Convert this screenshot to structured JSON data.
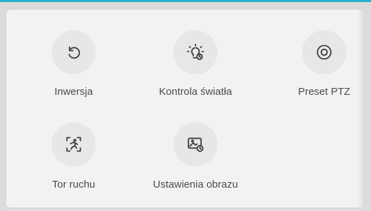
{
  "grid": {
    "items": [
      {
        "label": "Inwersja",
        "icon": "rotate-icon"
      },
      {
        "label": "Kontrola światła",
        "icon": "light-control-icon"
      },
      {
        "label": "Preset PTZ",
        "icon": "preset-ptz-icon"
      },
      {
        "label": "Tor ruchu",
        "icon": "motion-track-icon"
      },
      {
        "label": "Ustawienia obrazu",
        "icon": "image-settings-icon"
      }
    ]
  },
  "colors": {
    "accent": "#26b0d0",
    "panel_bg": "#f2f2f2",
    "icon_circle": "#e7e7e7",
    "text": "#4c4c4c"
  }
}
